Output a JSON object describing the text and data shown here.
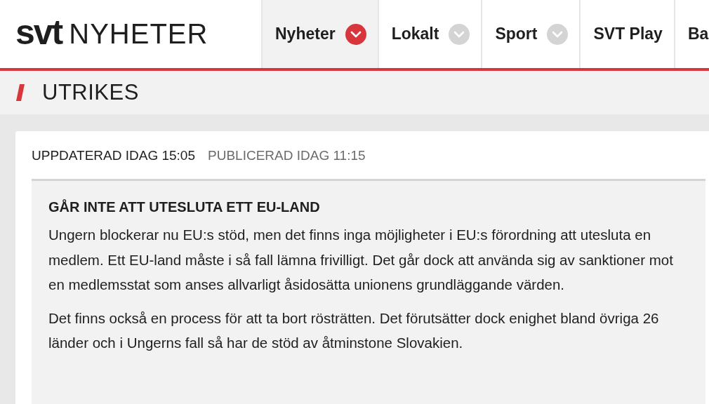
{
  "logo": {
    "brand": "svt",
    "section": "NYHETER"
  },
  "nav": [
    {
      "label": "Nyheter",
      "selected": true,
      "dropdown": true
    },
    {
      "label": "Lokalt",
      "selected": false,
      "dropdown": true
    },
    {
      "label": "Sport",
      "selected": false,
      "dropdown": true
    },
    {
      "label": "SVT Play",
      "selected": false,
      "dropdown": false
    },
    {
      "label": "Ba",
      "selected": false,
      "dropdown": false
    }
  ],
  "section": {
    "title": "UTRIKES"
  },
  "article": {
    "updated": "UPPDATERAD IDAG 15:05",
    "published": "PUBLICERAD IDAG 11:15",
    "factbox": {
      "title": "GÅR INTE ATT UTESLUTA ETT EU-LAND",
      "paragraphs": [
        "Ungern blockerar nu EU:s stöd, men det finns inga möjligheter i EU:s förordning att utesluta en medlem. Ett EU-land måste i så fall lämna frivilligt. Det går dock att använda sig av sanktioner mot en medlemsstat som anses allvarligt åsidosätta unionens grundläggande värden.",
        "Det finns också en process för att ta bort rösträtten. Det förutsätter dock enighet bland övriga 26 länder och i Ungerns fall så har de stöd av åtminstone Slovakien."
      ]
    }
  }
}
